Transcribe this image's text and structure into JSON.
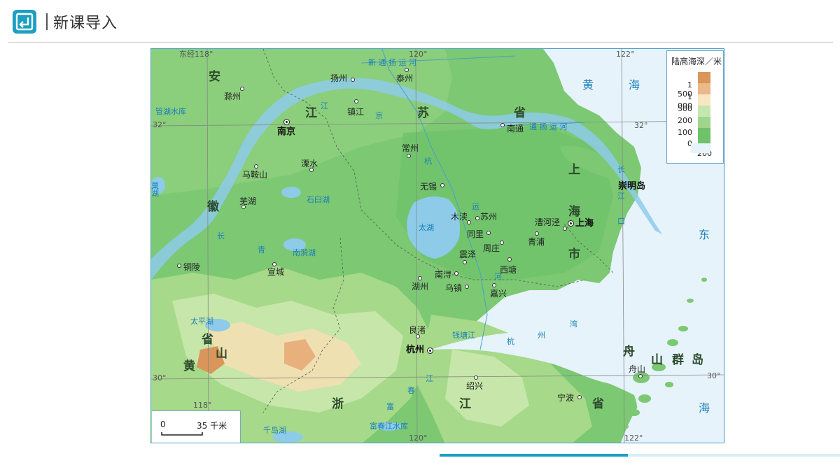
{
  "header": {
    "title": "新课导入",
    "logo_icon": "return-arrow-icon"
  },
  "legend": {
    "title": "陆高海深／米",
    "levels": [
      "1 500",
      "1 000",
      "500",
      "200",
      "100",
      "0",
      "200"
    ],
    "colors": [
      "#d9955a",
      "#eab88a",
      "#f7e8c3",
      "#c6e6b0",
      "#9fd58c",
      "#6fc26a",
      "#e6f3fb"
    ]
  },
  "grid": {
    "lon_118_top": "东经118°",
    "lon_120_top": "120°",
    "lon_122_top": "122°",
    "lat_32_left": "32°",
    "lat_32_right": "32°",
    "lat_30_left": "30°",
    "lat_30_right": "30°",
    "lon_118_bottom": "118°",
    "lon_120_bottom": "120°",
    "lon_122_bottom": "122°"
  },
  "provinces": {
    "jiangsu": [
      "江",
      "苏",
      "省"
    ],
    "anhui": [
      "安",
      "徽",
      "省"
    ],
    "zhejiang": [
      "浙",
      "江",
      "省"
    ],
    "shanghai": [
      "上",
      "海",
      "市"
    ],
    "zhoushan": [
      "舟",
      "山",
      "群",
      "岛"
    ],
    "huangshan": [
      "黄",
      "山"
    ]
  },
  "seas": {
    "yellow_sea": [
      "黄",
      "海"
    ],
    "east_sea": [
      "东",
      "海"
    ],
    "changjiang_kou": [
      "长",
      "江",
      "口"
    ],
    "hangzhou_wan": [
      "杭",
      "州",
      "湾"
    ]
  },
  "waters": {
    "taihu": "太湖",
    "shijiu": "石臼湖",
    "nanyi": "南漪湖",
    "chaohu": "巢湖",
    "taiping": "太平湖",
    "qiandao": "千岛湖",
    "fuchun_res": "富春江水库",
    "guanhuai": "管湖水库",
    "changjiang_w": "长",
    "jiang_w": "江",
    "qing": "青",
    "grand_canal_n": "新 通 扬 运 河",
    "tongyang": "通 扬 运 河",
    "jing": "京",
    "hang": "杭",
    "yun": "运",
    "he": "河",
    "fu": "富",
    "chun": "春",
    "jiang_s": "江",
    "qiantang": "钱塘江"
  },
  "cities": {
    "nanjing": "南京",
    "shanghai": "上海",
    "hangzhou": "杭州",
    "chuzhou": "滁州",
    "yangzhou": "扬州",
    "taizhou": "泰州",
    "zhenjiang": "镇江",
    "nantong": "南通",
    "changzhou": "常州",
    "maanshan": "马鞍山",
    "lishui": "溧水",
    "wuxi": "无锡",
    "wuhu": "芜湖",
    "mudu": "木渎",
    "suzhou": "苏州",
    "caohejing": "漕河泾",
    "tongli": "同里",
    "zhouzhuang": "周庄",
    "qingpu": "青浦",
    "zhenze": "震泽",
    "xitang": "西塘",
    "tongling": "铜陵",
    "xuancheng": "宣城",
    "nanxun": "南浔",
    "huzhou": "湖州",
    "wuzhen": "乌镇",
    "jiaxing": "嘉兴",
    "liangzhu": "良渚",
    "shaoxing": "绍兴",
    "ningbo": "宁波",
    "zhoushan": "舟山",
    "chongming": "崇明岛"
  },
  "scale": {
    "zero": "0",
    "distance": "35 千米"
  },
  "progress": {
    "value": 0.47
  }
}
